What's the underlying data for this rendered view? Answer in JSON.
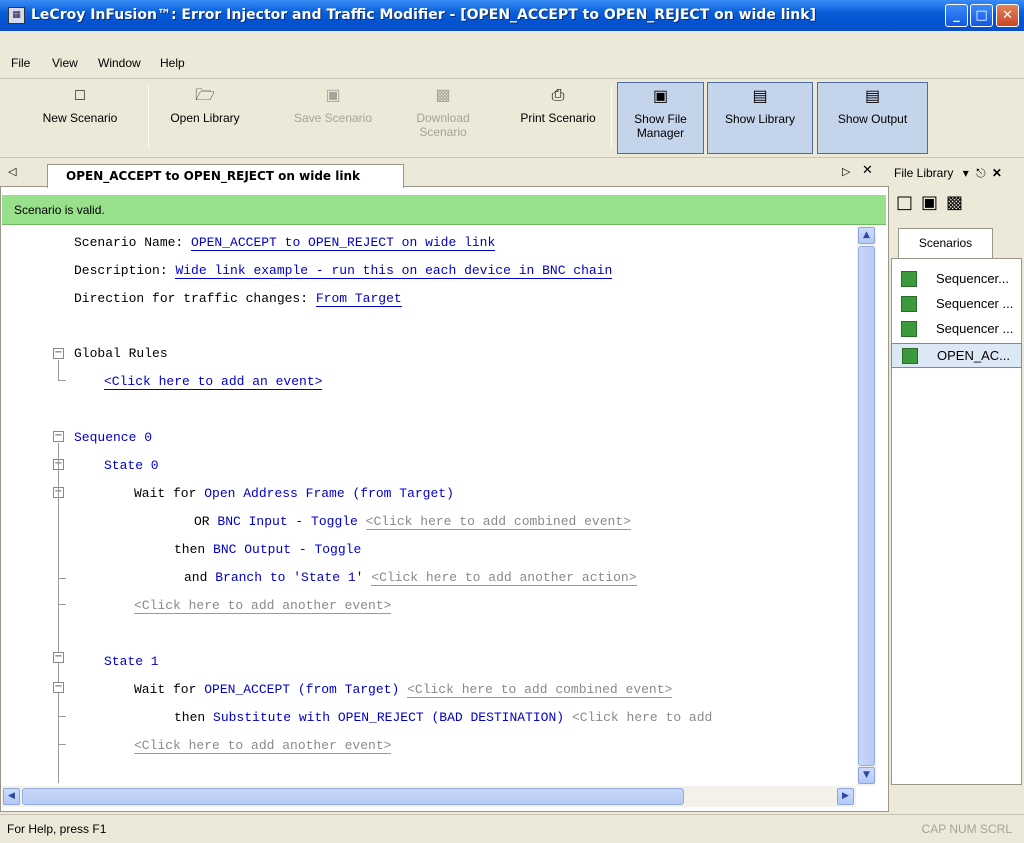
{
  "window": {
    "title": "LeCroy InFusion™: Error Injector and Traffic Modifier - [OPEN_ACCEPT to OPEN_REJECT on wide link]"
  },
  "menu": {
    "items": [
      "File",
      "View",
      "Window",
      "Help"
    ]
  },
  "toolbar": {
    "buttons": [
      {
        "label": "New Scenario",
        "icon": "new-document-icon"
      },
      {
        "label": "Open Library",
        "icon": "open-folder-icon"
      },
      {
        "label": "Save Scenario",
        "icon": "save-icon",
        "disabled": true
      },
      {
        "label": "Download Scenario",
        "icon": "download-icon",
        "disabled": true
      },
      {
        "label": "Print Scenario",
        "icon": "printer-icon"
      },
      {
        "label": "Show File Manager",
        "icon": "file-manager-icon",
        "toggled": true
      },
      {
        "label": "Show Library",
        "icon": "library-icon",
        "toggled": true
      },
      {
        "label": "Show Output",
        "icon": "output-icon",
        "toggled": true
      }
    ]
  },
  "doc": {
    "tab_label": "OPEN_ACCEPT to OPEN_REJECT on wide link",
    "status": "Scenario is valid.",
    "scenario_name_label": "Scenario Name:",
    "scenario_name": "OPEN_ACCEPT to OPEN_REJECT on wide link",
    "description_label": "Description:",
    "description": "Wide link example - run this on each device in BNC chain",
    "direction_label": "Direction for traffic changes:",
    "direction": "From Target",
    "global_rules": "Global Rules",
    "add_event": "<Click here to add an event>",
    "sequence0": "Sequence 0",
    "state0": "State 0",
    "wait_for": "Wait for",
    "s0_event": "Open Address Frame (from Target)",
    "or_label": "OR",
    "s0_or_event": "BNC Input - Toggle",
    "add_combined": "<Click here to add combined event>",
    "then_label": "then",
    "s0_action": "BNC Output - Toggle",
    "and_label": "and",
    "s0_action2": "Branch to 'State 1'",
    "add_action": "<Click here to add another action>",
    "add_another_event": "<Click here to add another event>",
    "state1": "State 1",
    "s1_event": "OPEN_ACCEPT (from Target)",
    "s1_action": "Substitute with OPEN_REJECT (BAD DESTINATION)",
    "add_action_trunc": "<Click here to add"
  },
  "library": {
    "title": "File Library",
    "tab": "Scenarios",
    "items": [
      "Sequencer...",
      "Sequencer ...",
      "Sequencer ...",
      "OPEN_AC..."
    ]
  },
  "status": {
    "help": "For Help, press F1",
    "indicators": "CAP  NUM  SCRL"
  }
}
